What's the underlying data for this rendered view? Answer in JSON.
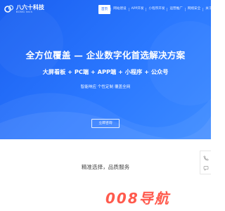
{
  "brand": {
    "name": "八六十科技",
    "sub": "BONG tech",
    "colors": {
      "primary": "#2b78ff",
      "white": "#ffffff",
      "watermark": "#ff5a4d"
    }
  },
  "nav": {
    "items": [
      {
        "label": "首页",
        "active": true
      },
      {
        "label": "网站建设",
        "active": false
      },
      {
        "label": "APP开发",
        "active": false
      },
      {
        "label": "小程序开发",
        "active": false
      },
      {
        "label": "运营推广",
        "active": false
      },
      {
        "label": "网络安全",
        "active": false
      },
      {
        "label": "关于我们",
        "active": false
      }
    ]
  },
  "hero": {
    "title": "全方位覆盖 — 企业数字化首选解决方案",
    "subtitle": "大屏看板 + PC端 + APP端 + 小程序 + 公众号",
    "tagline": "智能响应  个性定制  覆盖全网",
    "button": "立即咨询"
  },
  "section": {
    "title": "精准选择，品质服务"
  },
  "side_widget": {
    "icons": [
      "phone-icon",
      "wechat-icon"
    ]
  },
  "watermark": {
    "text": "008导航"
  }
}
